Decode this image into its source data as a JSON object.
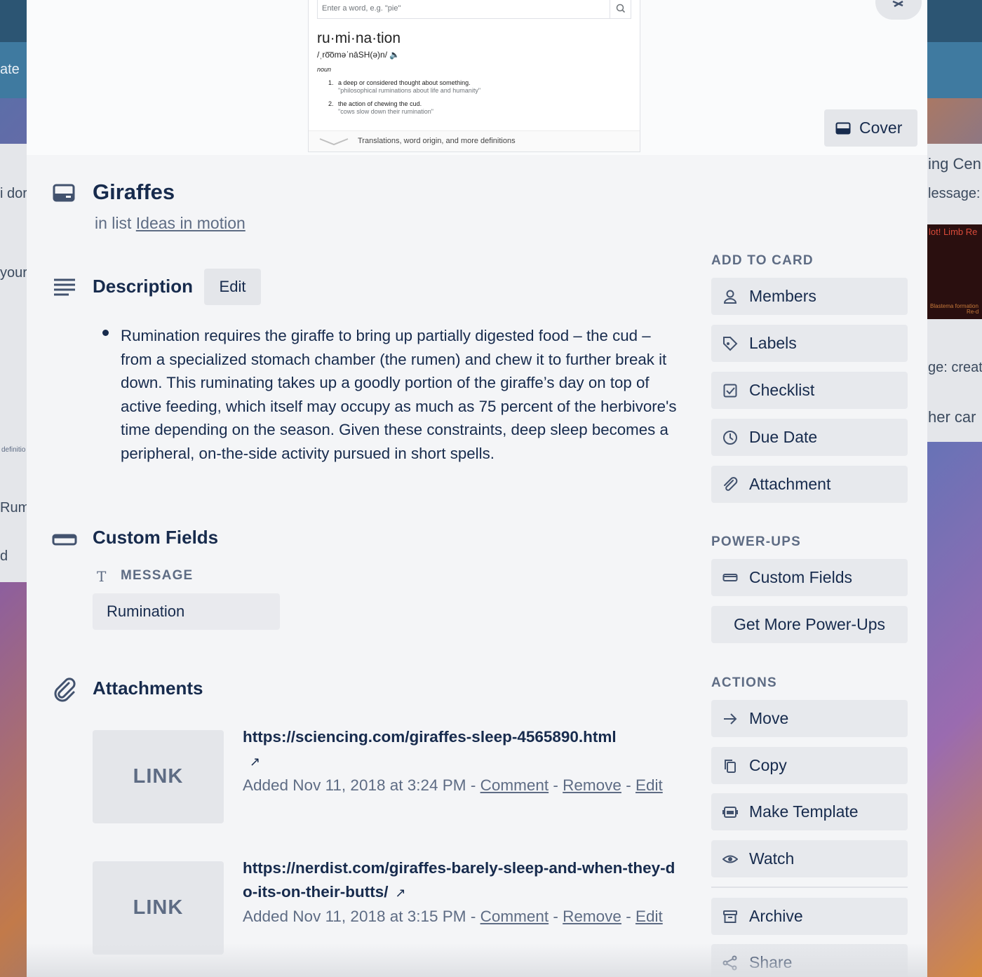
{
  "background": {
    "fragments": [
      "ate",
      "i dor",
      "your",
      "definitio",
      "Rum",
      "d",
      "ing Cen",
      "lessage:",
      "ge: creat",
      "her car",
      "lot! Limb Re",
      "Blastema formation",
      "Re-d"
    ]
  },
  "cover": {
    "dictionary": {
      "search_placeholder": "Enter a word, e.g. \"pie\"",
      "word": "ru·mi·na·tion",
      "pronunciation": "/ˌro͞oməˈnāSH(ə)n/",
      "part_of_speech": "noun",
      "definitions": [
        {
          "num": "1.",
          "text": "a deep or considered thought about something.",
          "example": "\"philosophical ruminations about life and humanity\""
        },
        {
          "num": "2.",
          "text": "the action of chewing the cud.",
          "example": "\"cows slow down their rumination\""
        }
      ],
      "footer": "Translations, word origin, and more definitions"
    },
    "cover_button": "Cover"
  },
  "card": {
    "title": "Giraffes",
    "in_list_prefix": "in list",
    "list_name": "Ideas in motion"
  },
  "description": {
    "heading": "Description",
    "edit_label": "Edit",
    "text": "Rumination requires the giraffe to bring up partially digested food – the cud – from a specialized stomach chamber (the rumen) and chew it to further break it down. This ruminating takes up a goodly portion of the giraffe’s day on top of active feeding, which itself may occupy as much as 75 percent of the herbivore's time depending on the season. Given these constraints, deep sleep becomes a peripheral, on-the-side activity pursued in short spells."
  },
  "custom_fields": {
    "heading": "Custom Fields",
    "field_label": "MESSAGE",
    "field_type_glyph": "T",
    "field_value": "Rumination"
  },
  "attachments": {
    "heading": "Attachments",
    "items": [
      {
        "thumb": "LINK",
        "url": "https://sciencing.com/giraffes-sleep-4565890.html",
        "added": "Added Nov 11, 2018 at 3:24 PM",
        "comment": "Comment",
        "remove": "Remove",
        "edit": "Edit",
        "sep": "-"
      },
      {
        "thumb": "LINK",
        "url": "https://nerdist.com/giraffes-barely-sleep-and-when-they-do-its-on-their-butts/",
        "added": "Added Nov 11, 2018 at 3:15 PM",
        "comment": "Comment",
        "remove": "Remove",
        "edit": "Edit",
        "sep": "-"
      }
    ]
  },
  "sidebar": {
    "add_to_card": {
      "heading": "ADD TO CARD",
      "items": [
        {
          "label": "Members",
          "icon": "person-icon"
        },
        {
          "label": "Labels",
          "icon": "tag-icon"
        },
        {
          "label": "Checklist",
          "icon": "checkbox-icon"
        },
        {
          "label": "Due Date",
          "icon": "clock-icon"
        },
        {
          "label": "Attachment",
          "icon": "paperclip-icon"
        }
      ]
    },
    "power_ups": {
      "heading": "POWER-UPS",
      "items": [
        {
          "label": "Custom Fields",
          "icon": "custom-fields-icon"
        },
        {
          "label": "Get More Power-Ups"
        }
      ]
    },
    "actions": {
      "heading": "ACTIONS",
      "items": [
        {
          "label": "Move",
          "icon": "arrow-right-icon"
        },
        {
          "label": "Copy",
          "icon": "copy-icon"
        },
        {
          "label": "Make Template",
          "icon": "template-icon"
        },
        {
          "label": "Watch",
          "icon": "eye-icon"
        },
        {
          "label": "Archive",
          "icon": "archive-icon"
        },
        {
          "label": "Share",
          "icon": "share-icon"
        }
      ]
    }
  },
  "colors": {
    "text": "#172b4d",
    "subtle": "#5e6c84",
    "button_bg": "#e7e9ed",
    "modal_bg": "#f4f5f7"
  }
}
